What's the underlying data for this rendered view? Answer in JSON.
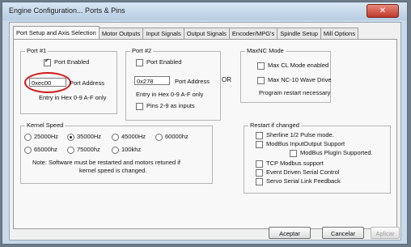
{
  "window": {
    "title": "Engine Configuration... Ports & Pins",
    "close_label": "✕"
  },
  "tabs": [
    "Port Setup and Axis Selection",
    "Motor Outputs",
    "Input Signals",
    "Output Signals",
    "Encoder/MPG's",
    "Spindle Setup",
    "Mill Options"
  ],
  "port1": {
    "group_label": "Port #1",
    "enabled_label": "Port Enabled",
    "address_value": "0xec00",
    "address_label": "Port Address",
    "hint": "Entry in Hex 0-9 A-F only"
  },
  "port2": {
    "group_label": "Port #2",
    "enabled_label": "Port Enabled",
    "address_value": "0x278",
    "address_label": "Port Address",
    "hint": "Entry in Hex 0-9 A-F only",
    "pins_label": "Pins 2-9 as inputs"
  },
  "or_label": "OR",
  "maxnc": {
    "group_label": "MaxNC Mode",
    "max_cl": "Max CL Mode enabled",
    "max_nc10": "Max NC-10 Wave Drive",
    "restart": "Program restart necessary"
  },
  "kernel": {
    "group_label": "Kernel Speed",
    "speeds": [
      "25000Hz",
      "35000Hz",
      "45000Hz",
      "60000hz",
      "65000hz",
      "75000hz",
      "100khz"
    ],
    "selected": "35000Hz",
    "note_line1": "Note: Software must be restarted and motors retuned if",
    "note_line2": "kernel speed is changed."
  },
  "restart": {
    "group_label": "Restart if changed",
    "sherline": "Sherline 1/2 Pulse mode.",
    "modbus": "ModBus InputOutput Support",
    "modbus_plugin": "ModBus PlugIn Supported.",
    "tcp": "TCP Modbus support",
    "event": "Event Driven Serial Control",
    "servo": "Servo Serial Link Feedback"
  },
  "buttons": {
    "accept": "Aceptar",
    "cancel": "Cancelar",
    "apply": "Aplicar"
  },
  "colors": {
    "annotation_circle": "#d01a1a"
  }
}
